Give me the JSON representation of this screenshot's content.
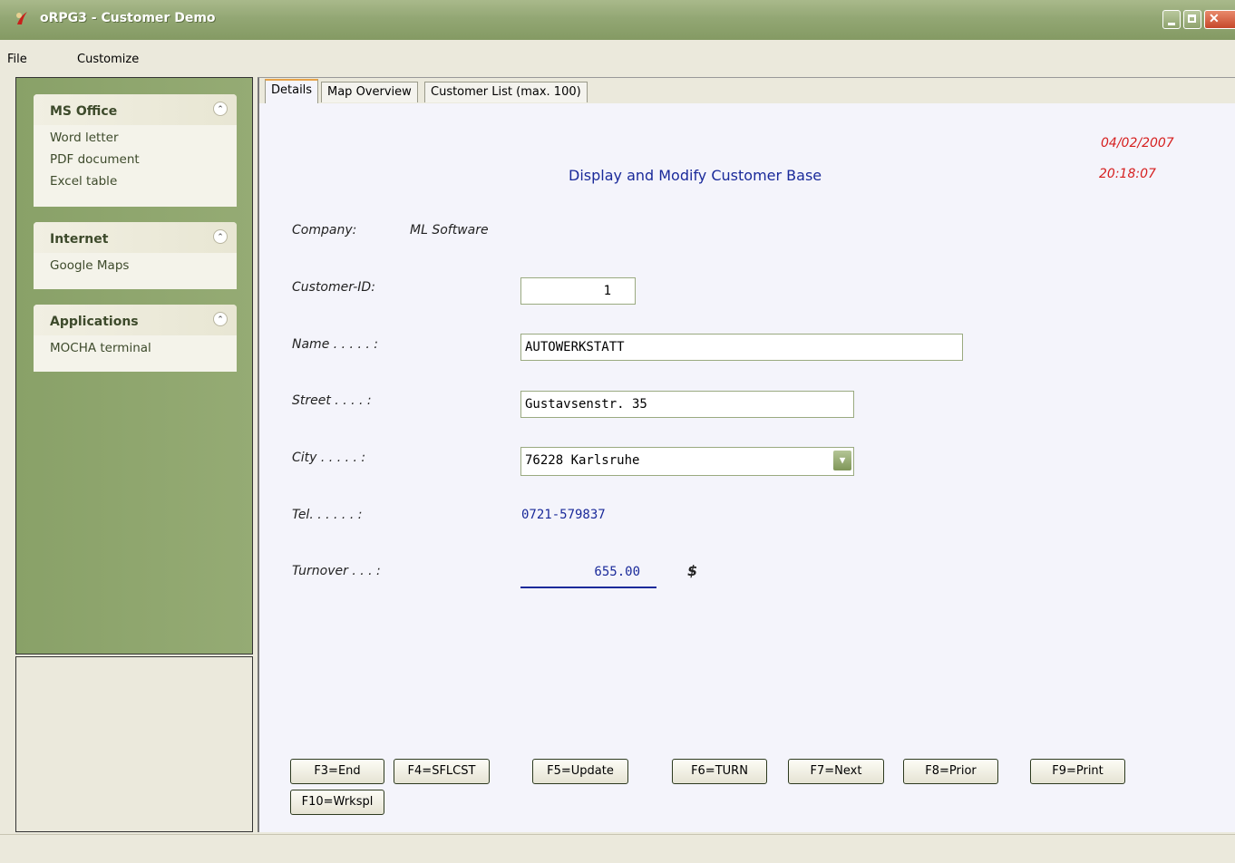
{
  "window": {
    "title": "oRPG3 - Customer Demo"
  },
  "menu": [
    "File",
    "Customize"
  ],
  "sidebar": {
    "groups": [
      {
        "title": "MS Office",
        "items": [
          "Word letter",
          "PDF document",
          "Excel table"
        ]
      },
      {
        "title": "Internet",
        "items": [
          "Google Maps"
        ]
      },
      {
        "title": "Applications",
        "items": [
          "MOCHA terminal"
        ]
      }
    ]
  },
  "tabs": [
    "Details",
    "Map Overview",
    "Customer List (max. 100)"
  ],
  "form": {
    "heading": "Display and Modify Customer Base",
    "date": "04/02/2007",
    "time": "20:18:07",
    "company_label": "Company:",
    "company_value": "ML Software",
    "customer_id_label": "Customer-ID:",
    "customer_id_value": "1",
    "name_label": "Name . . . . . :",
    "name_value": "AUTOWERKSTATT",
    "street_label": "Street . . . . :",
    "street_value": "Gustavsenstr. 35",
    "city_label": "City . . . . . :",
    "city_value": "76228 Karlsruhe",
    "tel_label": "Tel. . . . . . :",
    "tel_value": "0721-579837",
    "turnover_label": "Turnover . . . :",
    "turnover_value": "655.00",
    "currency": "$"
  },
  "fkeys": [
    "F3=End",
    "F4=SFLCST",
    "F5=Update",
    "F6=TURN",
    "F7=Next",
    "F8=Prior",
    "F9=Print",
    "F10=Wrkspl"
  ],
  "colors": {
    "sidebar": "#8fa56e",
    "accent_tab": "#e7a34a",
    "date_red": "#d62020",
    "value_blue": "#1a2a9a"
  }
}
